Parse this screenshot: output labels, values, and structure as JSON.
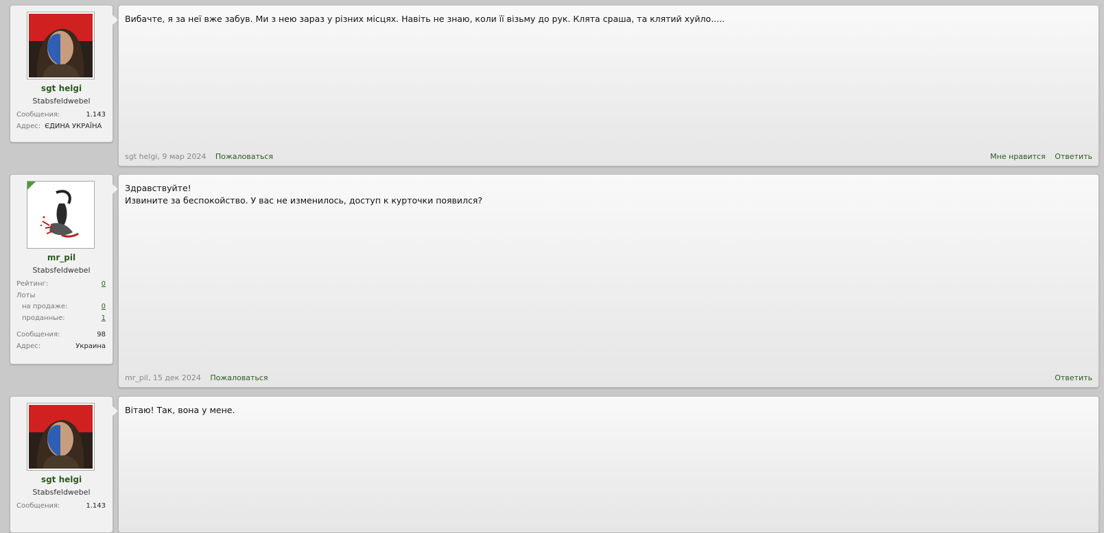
{
  "posts": [
    {
      "user": {
        "name": "sgt helgi",
        "title": "Stabsfeldwebel",
        "avatar": "braveheart-avatar",
        "stats": [
          {
            "label": "Сообщения:",
            "value": "1.143"
          },
          {
            "label": "Адрес:",
            "value": "ЄДИНА УКРАЇНА"
          }
        ]
      },
      "text": "Вибачте, я за неї вже забув. Ми з нею зараз у різних місцях. Навіть не знаю, коли її візьму до рук. Клята сраша, та клятий хуйло.....",
      "meta": "sgt helgi, 9 мар 2024",
      "report": "Пожаловаться",
      "like": "Мне нравится",
      "reply": "Ответить"
    },
    {
      "user": {
        "name": "mr_pil",
        "title": "Stabsfeldwebel",
        "avatar": "helmet-sketch-avatar",
        "stats": [
          {
            "label": "Рейтинг:",
            "value": "0"
          },
          {
            "label": "Лоты",
            "value": ""
          },
          {
            "label": "на продаже:",
            "value": "0"
          },
          {
            "label": "проданные:",
            "value": "1"
          },
          {
            "label": "Сообщения:",
            "value": "98"
          },
          {
            "label": "Адрес:",
            "value": "Украина"
          }
        ]
      },
      "text": "Здравствуйте!\nИзвините за беспокойство. У вас не изменилось, доступ к курточки появился?",
      "meta": "mr_pil, 15 дек 2024",
      "report": "Пожаловаться",
      "reply": "Ответить"
    },
    {
      "user": {
        "name": "sgt helgi",
        "title": "Stabsfeldwebel",
        "avatar": "braveheart-avatar",
        "stats": [
          {
            "label": "Сообщения:",
            "value": "1.143"
          }
        ]
      },
      "text": "Вітаю! Так, вона у мене."
    }
  ]
}
